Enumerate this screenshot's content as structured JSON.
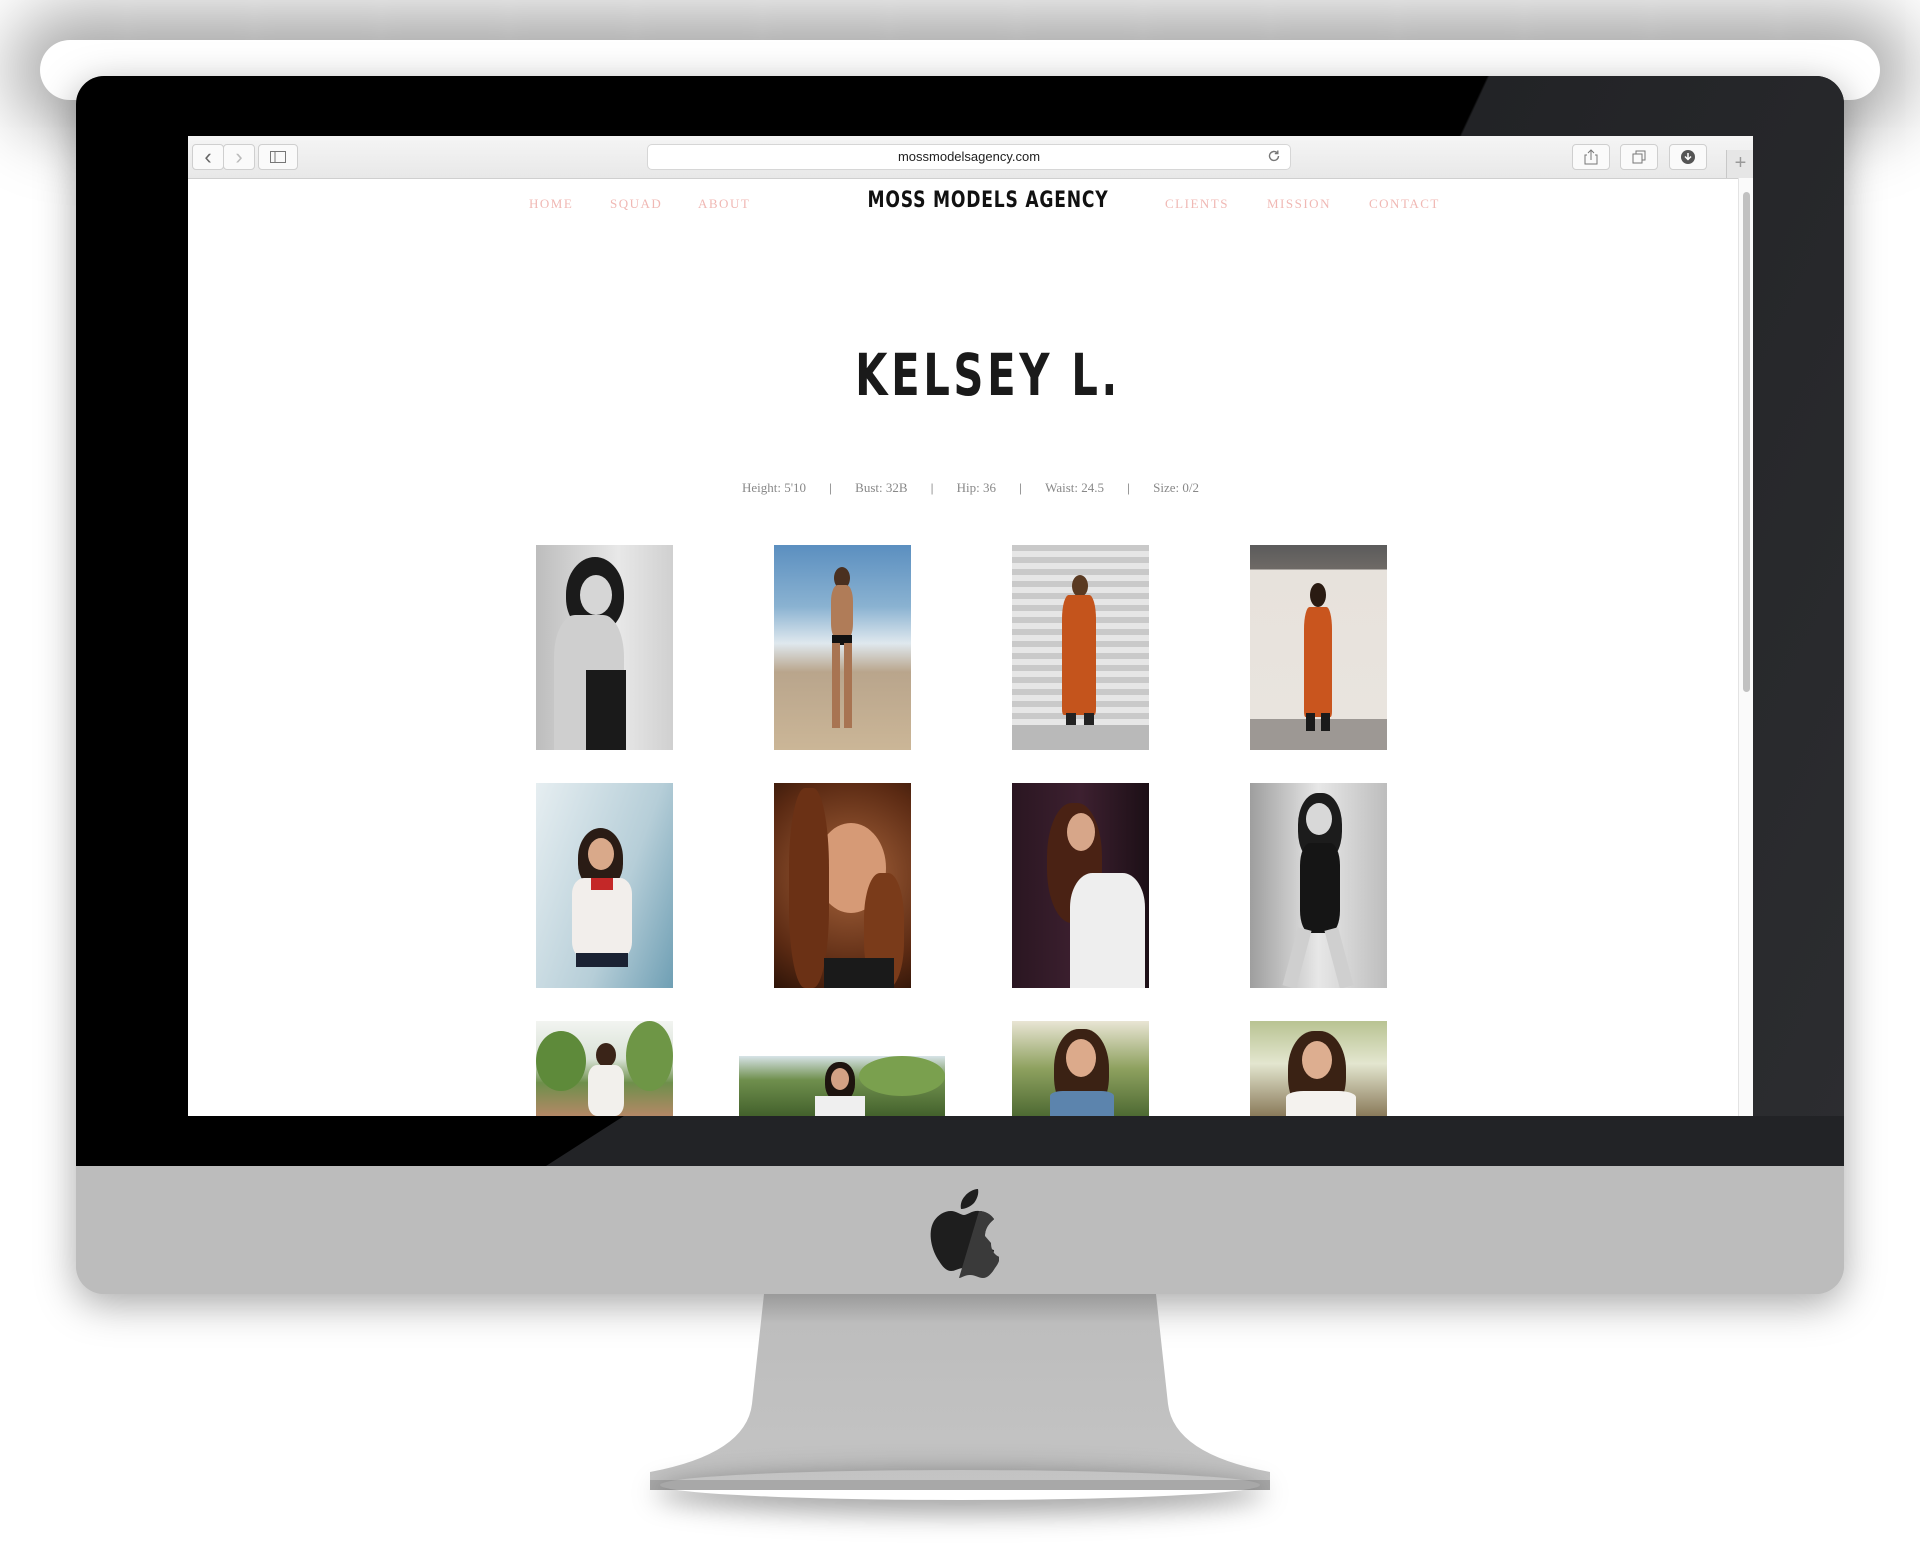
{
  "browser": {
    "url": "mossmodelsagency.com",
    "new_tab_glyph": "+",
    "back_glyph": "‹",
    "forward_glyph": "›"
  },
  "nav": {
    "left": [
      "HOME",
      "SQUAD",
      "ABOUT"
    ],
    "right": [
      "CLIENTS",
      "MISSION",
      "CONTACT"
    ],
    "brand": "MOSS MODELS AGENCY",
    "link_color": "#f0b8b4"
  },
  "model": {
    "name": "KELSEY L.",
    "stats": [
      "Height: 5'10",
      "Bust: 32B",
      "Hip: 36",
      "Waist: 24.5",
      "Size: 0/2"
    ],
    "separator": "|"
  },
  "gallery": {
    "rows": [
      [
        "bw-portrait",
        "beach-swimsuit",
        "orange-jumpsuit-shutter",
        "orange-jumpsuit-wall"
      ],
      [
        "laughing-tee",
        "closeup-portrait",
        "white-tee-profile",
        "bw-bodysuit"
      ],
      [
        "palm-trees",
        "palm-garden",
        "denim-shirt",
        "white-top-smile"
      ]
    ]
  },
  "icons": [
    "back-icon",
    "forward-icon",
    "sidebar-icon",
    "reload-icon",
    "share-icon",
    "tabs-icon",
    "download-icon",
    "apple-logo-icon"
  ]
}
